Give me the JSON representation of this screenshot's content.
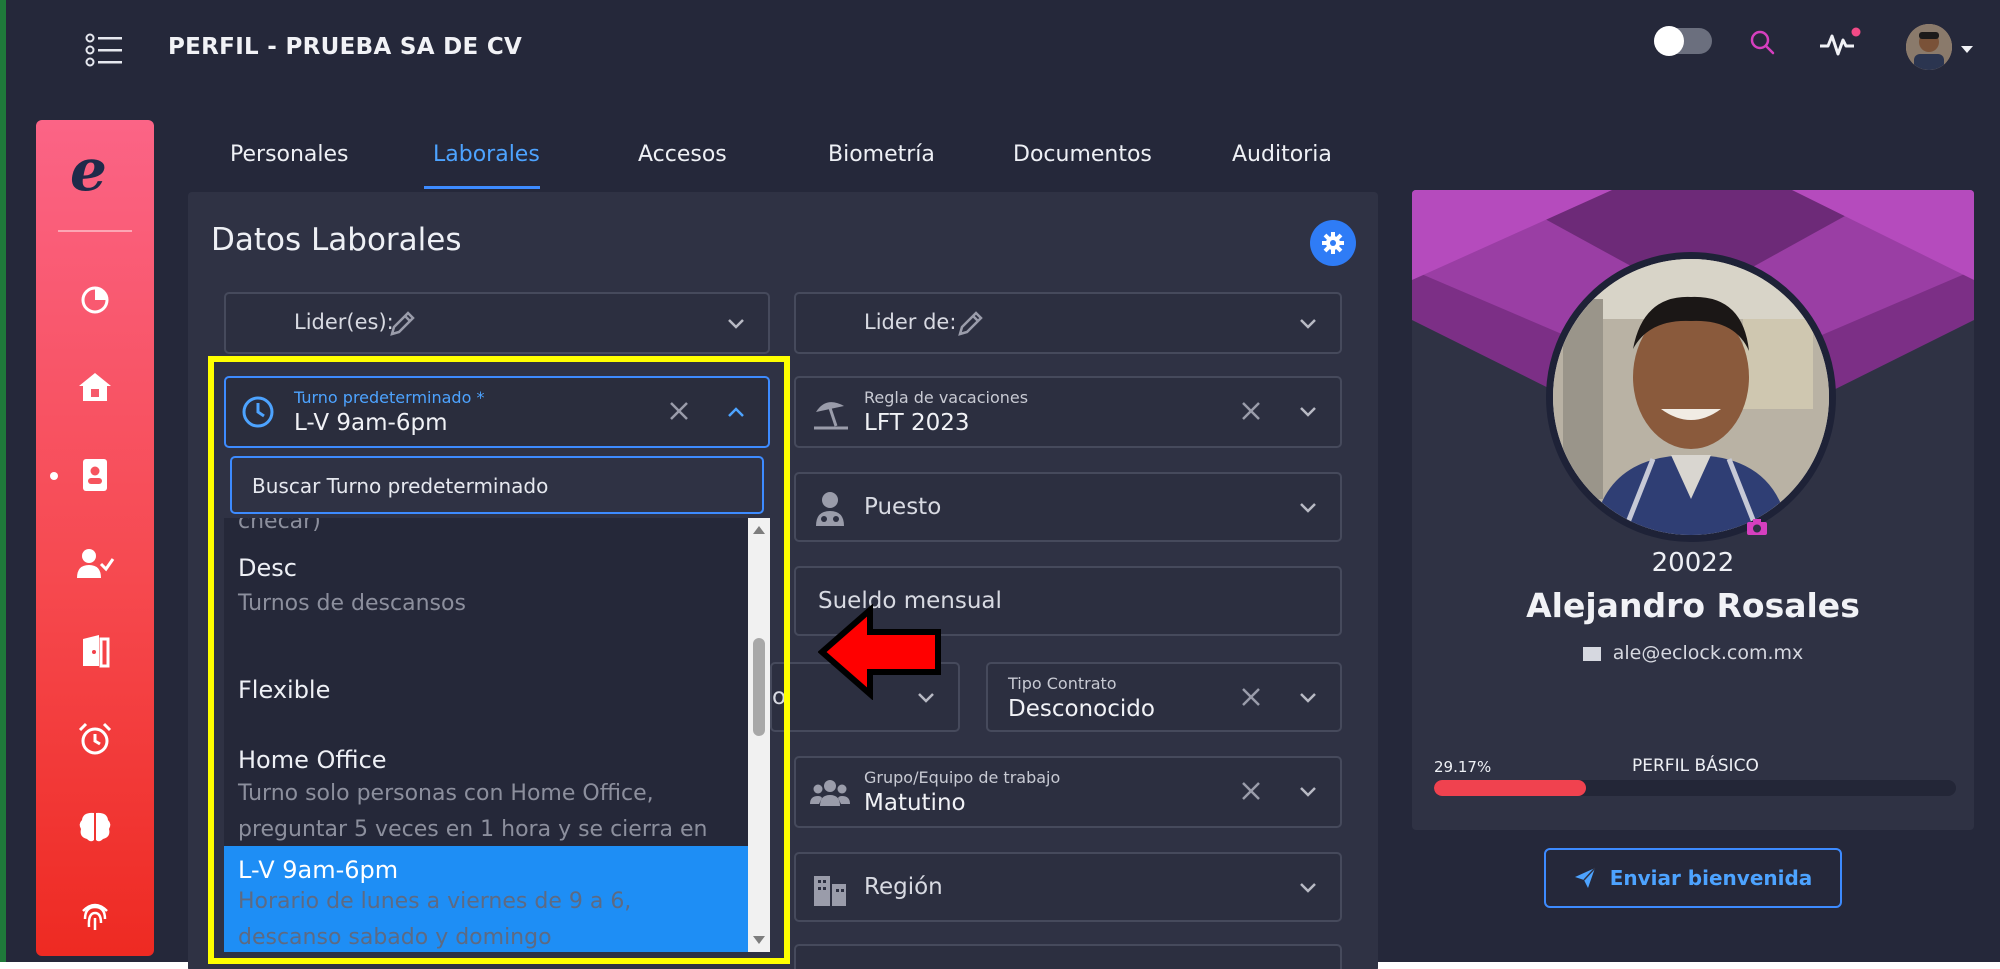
{
  "header": {
    "title": "PERFIL - PRUEBA SA DE CV",
    "icons": [
      "menu-list-icon",
      "theme-toggle",
      "search-icon",
      "activity-icon",
      "user-avatar",
      "caret-down-icon"
    ]
  },
  "sidebar": {
    "brand_icon": "eclock-logo-icon",
    "items": [
      {
        "icon": "pie-chart-icon"
      },
      {
        "icon": "home-icon"
      },
      {
        "icon": "address-book-icon",
        "active": true
      },
      {
        "icon": "user-check-icon"
      },
      {
        "icon": "door-exit-icon"
      },
      {
        "icon": "alarm-clock-icon"
      },
      {
        "icon": "brain-icon"
      },
      {
        "icon": "fingerprint-icon"
      }
    ]
  },
  "tabs": [
    {
      "label": "Personales"
    },
    {
      "label": "Laborales",
      "active": true
    },
    {
      "label": "Accesos"
    },
    {
      "label": "Biometría"
    },
    {
      "label": "Documentos"
    },
    {
      "label": "Auditoria"
    }
  ],
  "form": {
    "title": "Datos Laborales",
    "lider_es": {
      "label": "Lider(es):"
    },
    "lider_de": {
      "label": "Lider de:"
    },
    "turno": {
      "label": "Turno predeterminado *",
      "value": "L-V 9am-6pm"
    },
    "vacaciones": {
      "label": "Regla de vacaciones",
      "value": "LFT 2023"
    },
    "puesto": {
      "placeholder": "Puesto"
    },
    "sueldo": {
      "placeholder": "Sueldo mensual"
    },
    "contrato": {
      "label": "Tipo Contrato",
      "value": "Desconocido"
    },
    "grupo": {
      "label": "Grupo/Equipo de trabajo",
      "value": "Matutino"
    },
    "region": {
      "placeholder": "Región"
    },
    "partial_field_letter": "o"
  },
  "dropdown": {
    "search_placeholder": "Buscar Turno predeterminado",
    "partial_top": "checar)",
    "options": [
      {
        "name": "Desc",
        "description": "Turnos de descansos"
      },
      {
        "name": "Flexible",
        "description": ""
      },
      {
        "name": "Home Office",
        "description": "Turno solo personas con Home Office, preguntar 5 veces en 1 hora y se cierra en"
      },
      {
        "name": "L-V 9am-6pm",
        "description": "Horario de lunes a viernes de 9 a 6, descanso sabado y domingo",
        "selected": true
      }
    ]
  },
  "profile": {
    "employee_id": "20022",
    "name": "Alejandro Rosales",
    "email": "ale@eclock.com.mx",
    "progress_label": "PERFIL BÁSICO",
    "progress_text": "29.17%",
    "progress_value": 29.17,
    "welcome_button": "Enviar bienvenida"
  },
  "colors": {
    "accent": "#3d8bff",
    "highlight": "#ffff00",
    "arrow": "#ff0000",
    "progress": "#f0424f"
  }
}
